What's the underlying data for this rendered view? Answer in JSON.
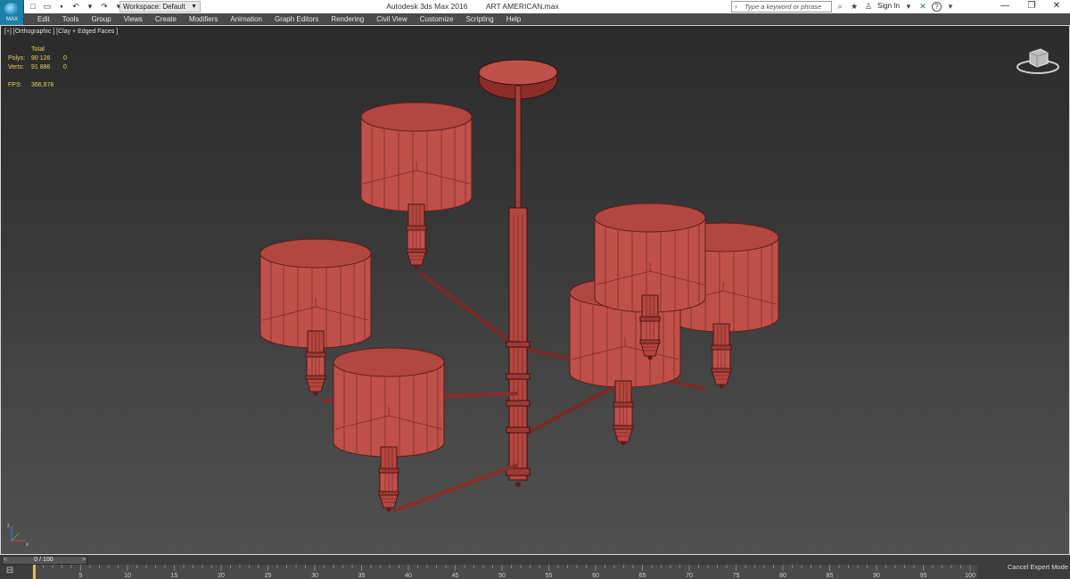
{
  "app": {
    "logo_text": "MAX",
    "title": "Autodesk 3ds Max 2016",
    "file": "ART AMERICAN.max"
  },
  "quick_access": {
    "icons": [
      "new-file-icon",
      "open-file-icon",
      "save-icon",
      "undo-icon",
      "redo-icon",
      "project-folder-icon"
    ]
  },
  "workspace": {
    "label": "Workspace: Default"
  },
  "search": {
    "placeholder": "Type a keyword or phrase"
  },
  "account": {
    "sign_in": "Sign In"
  },
  "menu": [
    "Edit",
    "Tools",
    "Group",
    "Views",
    "Create",
    "Modifiers",
    "Animation",
    "Graph Editors",
    "Rendering",
    "Civil View",
    "Customize",
    "Scripting",
    "Help"
  ],
  "viewport": {
    "label": "[+] [Orthographic ] [Clay + Edged Faces ]",
    "stats": {
      "header": "Total",
      "polys_label": "Polys:",
      "polys_total": "90 126",
      "polys_sel": "0",
      "verts_label": "Verts:",
      "verts_total": "91 886",
      "verts_sel": "0",
      "fps_label": "FPS:",
      "fps": "366,878"
    },
    "model_color": "#c0504a",
    "background_top": "#2b2b2b",
    "background_bottom": "#505050"
  },
  "timeline": {
    "frame_range": "0 / 100",
    "ticks": [
      "0",
      "5",
      "10",
      "15",
      "20",
      "25",
      "30",
      "35",
      "40",
      "45",
      "50",
      "55",
      "60",
      "65",
      "70",
      "75",
      "80",
      "85",
      "90",
      "95",
      "100"
    ]
  },
  "status": {
    "cancel_expert_mode": "Cancel Expert Mode"
  }
}
